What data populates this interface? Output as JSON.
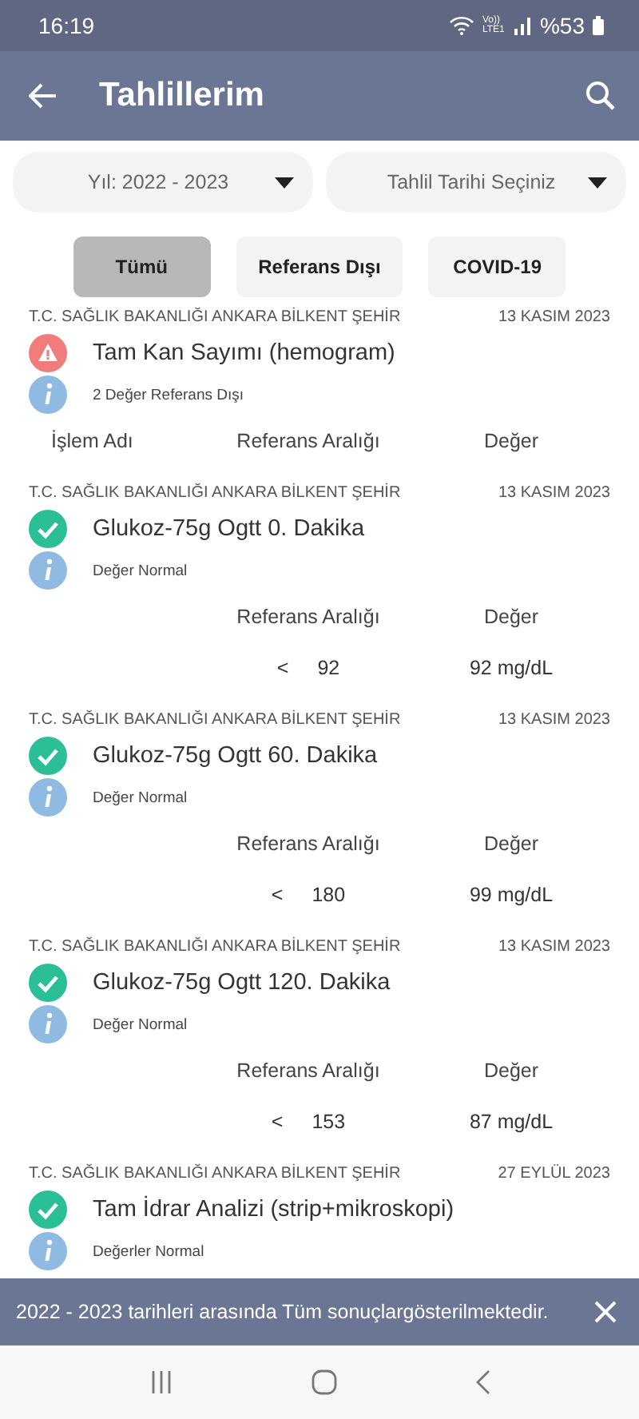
{
  "status_bar": {
    "time": "16:19",
    "network": "Vo)) LTE1",
    "battery": "%53"
  },
  "header": {
    "title": "Tahlillerim"
  },
  "filters": [
    {
      "label": "Yıl: 2022 - 2023"
    },
    {
      "label": "Tahlil Tarihi Seçiniz"
    }
  ],
  "chips": [
    {
      "label": "Tümü",
      "selected": true
    },
    {
      "label": "Referans Dışı",
      "selected": false
    },
    {
      "label": "COVID-19",
      "selected": false
    }
  ],
  "results": [
    {
      "hospital": "T.C. SAĞLIK BAKANLIĞI ANKARA BİLKENT ŞEHİR",
      "date": "13 KASIM 2023",
      "name": "Tam Kan Sayımı (hemogram)",
      "kind": "warning",
      "summary": "2 Değer Referans Dışı",
      "columns": [
        "İşlem Adı",
        "Referans Aralığı",
        "Değer"
      ]
    },
    {
      "hospital": "T.C. SAĞLIK BAKANLIĞI ANKARA BİLKENT ŞEHİR",
      "date": "13 KASIM 2023",
      "name": "Glukoz-75g Ogtt 0. Dakika",
      "kind": "ok",
      "summary": "Değer Normal",
      "columns": [
        "Referans Aralığı",
        "Değer"
      ],
      "row": {
        "operator": "<",
        "limit": "92",
        "value": "92 mg/dL"
      }
    },
    {
      "hospital": "T.C. SAĞLIK BAKANLIĞI ANKARA BİLKENT ŞEHİR",
      "date": "13 KASIM 2023",
      "name": "Glukoz-75g Ogtt 60. Dakika",
      "kind": "ok",
      "summary": "Değer Normal",
      "columns": [
        "Referans Aralığı",
        "Değer"
      ],
      "row": {
        "operator": "<",
        "limit": "180",
        "value": "99 mg/dL"
      }
    },
    {
      "hospital": "T.C. SAĞLIK BAKANLIĞI ANKARA BİLKENT ŞEHİR",
      "date": "13 KASIM 2023",
      "name": "Glukoz-75g Ogtt 120. Dakika",
      "kind": "ok",
      "summary": "Değer Normal",
      "columns": [
        "Referans Aralığı",
        "Değer"
      ],
      "row": {
        "operator": "<",
        "limit": "153",
        "value": "87 mg/dL"
      }
    },
    {
      "hospital": "T.C. SAĞLIK BAKANLIĞI ANKARA BİLKENT ŞEHİR",
      "date": "27 EYLÜL 2023",
      "name": "Tam İdrar Analizi (strip+mikroskopi)",
      "kind": "ok",
      "summary": "Değerler Normal"
    }
  ],
  "snackbar": {
    "message": "2022 - 2023 tarihleri arasında Tüm sonuçlargösterilmektedir."
  }
}
